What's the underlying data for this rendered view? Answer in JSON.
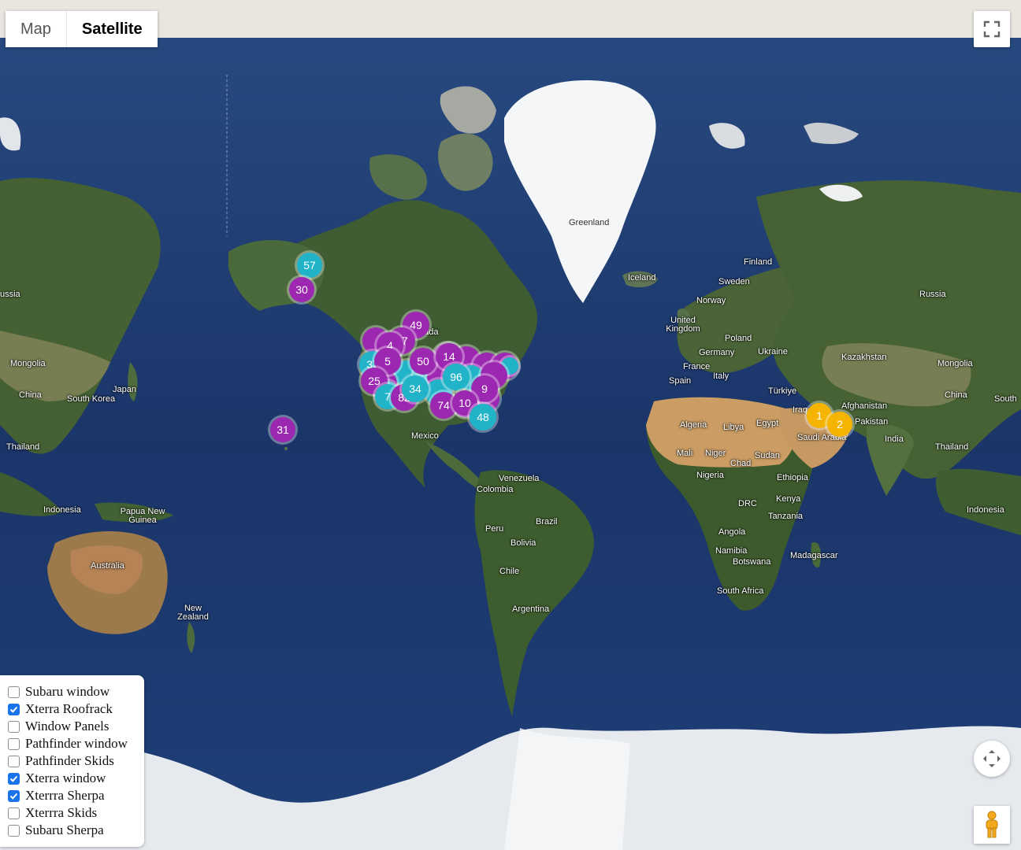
{
  "map_types": {
    "map_label": "Map",
    "satellite_label": "Satellite",
    "active": "satellite"
  },
  "controls": {
    "fullscreen": "fullscreen-icon",
    "recenter": "recenter-icon",
    "street_view": "pegman-icon"
  },
  "legend": [
    {
      "label": "Subaru window",
      "checked": false
    },
    {
      "label": "Xterra Roofrack",
      "checked": true
    },
    {
      "label": "Window Panels",
      "checked": false
    },
    {
      "label": "Pathfinder window",
      "checked": false
    },
    {
      "label": "Pathfinder Skids",
      "checked": false
    },
    {
      "label": "Xterra window",
      "checked": true
    },
    {
      "label": "Xterrra Sherpa",
      "checked": true
    },
    {
      "label": "Xterrra Skids",
      "checked": false
    },
    {
      "label": "Subaru Sherpa",
      "checked": false
    }
  ],
  "colors": {
    "purple": "#9c27b0",
    "cyan": "#21b4c9",
    "orange": "#f4b400",
    "ocean": "#1d3b70",
    "land": "#3d5a30",
    "desert": "#c89a62",
    "ice": "#f2f4f6"
  },
  "clusters": [
    {
      "count": "57",
      "color": "cyan"
    },
    {
      "count": "30",
      "color": "purple"
    },
    {
      "count": "49",
      "color": "purple"
    },
    {
      "count": "17",
      "color": "purple"
    },
    {
      "count": "4",
      "color": "purple"
    },
    {
      "count": "37",
      "color": "cyan"
    },
    {
      "count": "5",
      "color": "purple"
    },
    {
      "count": "50",
      "color": "purple"
    },
    {
      "count": "14",
      "color": "purple"
    },
    {
      "count": "25",
      "color": "purple"
    },
    {
      "count": "7",
      "color": "cyan"
    },
    {
      "count": "82",
      "color": "purple"
    },
    {
      "count": "34",
      "color": "cyan"
    },
    {
      "count": "96",
      "color": "cyan"
    },
    {
      "count": "9",
      "color": "purple"
    },
    {
      "count": "74",
      "color": "purple"
    },
    {
      "count": "10",
      "color": "purple"
    },
    {
      "count": "48",
      "color": "cyan"
    },
    {
      "count": "31",
      "color": "purple"
    },
    {
      "count": "1",
      "color": "orange"
    },
    {
      "count": "2",
      "color": "orange"
    }
  ],
  "place_labels": [
    "Greenland",
    "Finland",
    "Sweden",
    "Norway",
    "Iceland",
    "Russia",
    "ussia",
    "United Kingdom",
    "Poland",
    "Germany",
    "Ukraine",
    "France",
    "Spain",
    "Italy",
    "Kazakhstan",
    "Mongolia",
    "Mongolia",
    "China",
    "China",
    "Japan",
    "South Korea",
    "South",
    "Türkiye",
    "Iraq",
    "Afghanistan",
    "Pakistan",
    "Saudi Arabia",
    "Egypt",
    "Libya",
    "Algeria",
    "Mali",
    "Niger",
    "Chad",
    "Sudan",
    "Nigeria",
    "Ethiopia",
    "DRC",
    "Kenya",
    "Tanzania",
    "Angola",
    "Namibia",
    "Botswana",
    "South Africa",
    "Madagascar",
    "India",
    "Thailand",
    "Thailand",
    "Indonesia",
    "Indonesia",
    "Papua New Guinea",
    "Australia",
    "New Zealand",
    "Mexico",
    "Venezuela",
    "Colombia",
    "Peru",
    "Brazil",
    "Bolivia",
    "Chile",
    "Argentina",
    "nada"
  ]
}
